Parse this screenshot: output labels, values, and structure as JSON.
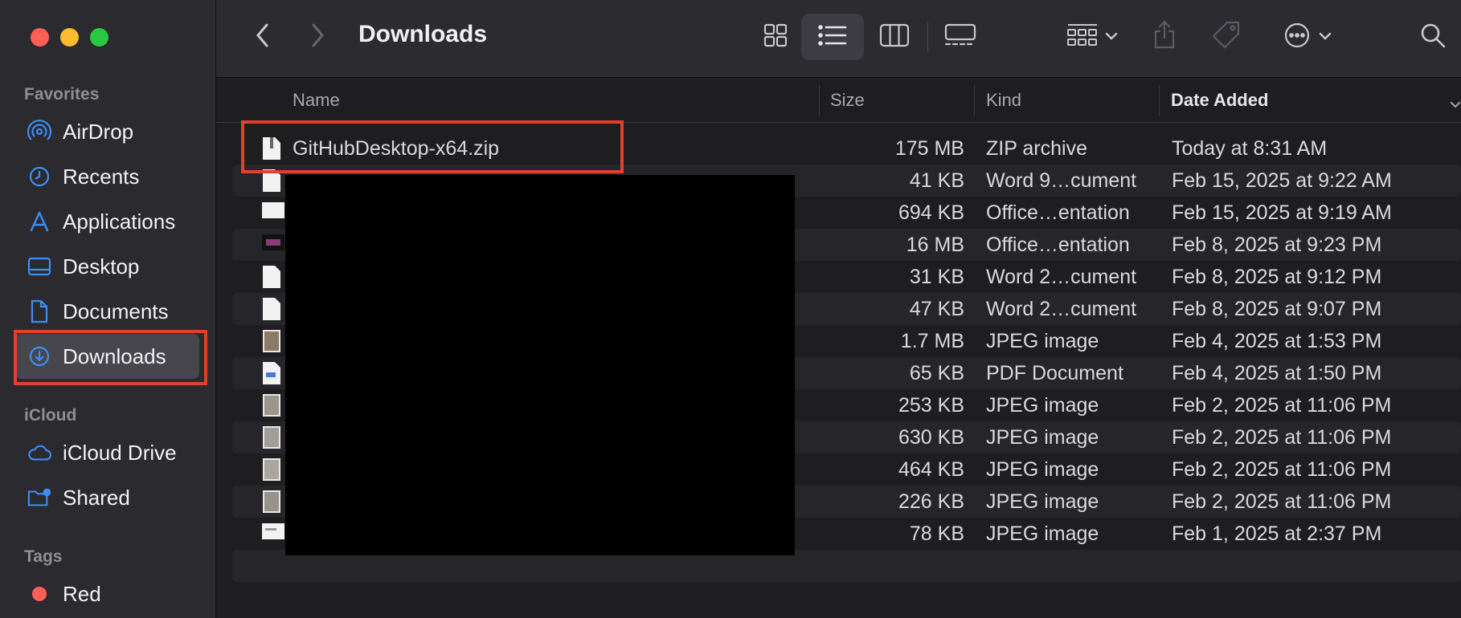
{
  "window": {
    "title": "Downloads"
  },
  "sidebar": {
    "favorites_label": "Favorites",
    "icloud_label": "iCloud",
    "tags_label": "Tags",
    "favorites": [
      {
        "label": "AirDrop",
        "icon": "airdrop-icon"
      },
      {
        "label": "Recents",
        "icon": "clock-icon"
      },
      {
        "label": "Applications",
        "icon": "applications-icon"
      },
      {
        "label": "Desktop",
        "icon": "desktop-icon"
      },
      {
        "label": "Documents",
        "icon": "document-icon"
      },
      {
        "label": "Downloads",
        "icon": "download-icon",
        "selected": true
      }
    ],
    "icloud": [
      {
        "label": "iCloud Drive",
        "icon": "cloud-icon"
      },
      {
        "label": "Shared",
        "icon": "shared-folder-icon"
      }
    ],
    "tags": [
      {
        "label": "Red",
        "color": "#ff5f57"
      }
    ]
  },
  "columns": {
    "name": "Name",
    "size": "Size",
    "kind": "Kind",
    "date": "Date Added"
  },
  "files": [
    {
      "name": "GitHubDesktop-x64.zip",
      "size": "175 MB",
      "kind": "ZIP archive",
      "date": "Today at 8:31 AM",
      "icon": "zip-icon"
    },
    {
      "name": "",
      "size": "41 KB",
      "kind": "Word 9…cument",
      "date": "Feb 15, 2025 at 9:22 AM",
      "icon": "doc-icon"
    },
    {
      "name": "",
      "size": "694 KB",
      "kind": "Office…entation",
      "date": "Feb 15, 2025 at 9:19 AM",
      "icon": "presentation-icon"
    },
    {
      "name": "",
      "size": "16 MB",
      "kind": "Office…entation",
      "date": "Feb 8, 2025 at 9:23 PM",
      "icon": "presentation-thumb-icon"
    },
    {
      "name": "",
      "size": "31 KB",
      "kind": "Word 2…cument",
      "date": "Feb 8, 2025 at 9:12 PM",
      "icon": "doc-icon"
    },
    {
      "name": "",
      "size": "47 KB",
      "kind": "Word 2…cument",
      "date": "Feb 8, 2025 at 9:07 PM",
      "icon": "doc-icon"
    },
    {
      "name": "",
      "size": "1.7 MB",
      "kind": "JPEG image",
      "date": "Feb 4, 2025 at 1:53 PM",
      "icon": "image-icon"
    },
    {
      "name": "",
      "size": "65 KB",
      "kind": "PDF Document",
      "date": "Feb 4, 2025 at 1:50 PM",
      "icon": "pdf-icon"
    },
    {
      "name": "",
      "size": "253 KB",
      "kind": "JPEG image",
      "date": "Feb 2, 2025 at 11:06 PM",
      "icon": "image-icon"
    },
    {
      "name": "",
      "size": "630 KB",
      "kind": "JPEG image",
      "date": "Feb 2, 2025 at 11:06 PM",
      "icon": "image-icon"
    },
    {
      "name": "",
      "size": "464 KB",
      "kind": "JPEG image",
      "date": "Feb 2, 2025 at 11:06 PM",
      "icon": "image-icon"
    },
    {
      "name": "",
      "size": "226 KB",
      "kind": "JPEG image",
      "date": "Feb 2, 2025 at 11:06 PM",
      "icon": "image-icon"
    },
    {
      "name": "",
      "size": "78 KB",
      "kind": "JPEG image",
      "date": "Feb 1, 2025 at 2:37 PM",
      "icon": "image-icon"
    }
  ],
  "colors": {
    "accent": "#3e8ef7",
    "highlight": "#e0412c",
    "close": "#ff5f57",
    "minimize": "#febc2e",
    "zoom": "#28c840"
  }
}
